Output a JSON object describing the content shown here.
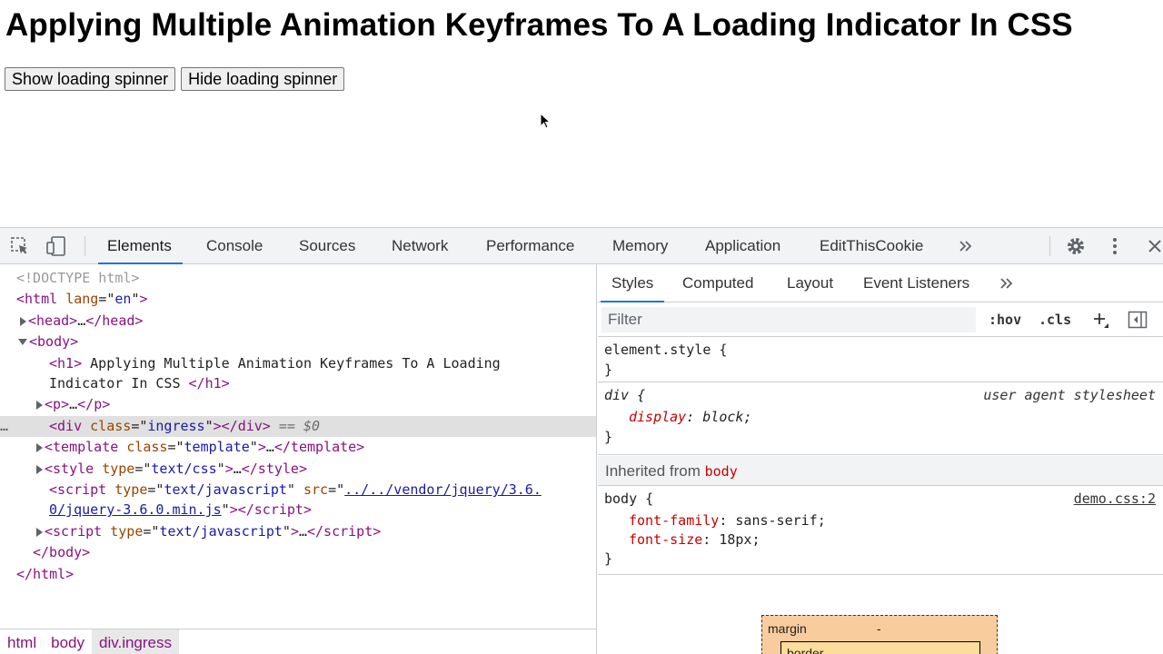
{
  "page": {
    "title": "Applying Multiple Animation Keyframes To A Loading Indicator In CSS",
    "show_button": "Show loading spinner",
    "hide_button": "Hide loading spinner"
  },
  "devtools": {
    "tabs": [
      "Elements",
      "Console",
      "Sources",
      "Network",
      "Performance",
      "Memory",
      "Application",
      "EditThisCookie"
    ],
    "active_tab": "Elements",
    "more_tabs_icon": "chevron-double-right-icon",
    "icons": [
      "inspect-element-icon",
      "device-toolbar-icon",
      "gear-icon",
      "kebab-menu-icon",
      "close-icon"
    ],
    "accent_color": "#1a73e8"
  },
  "dom": {
    "doctype": "<!DOCTYPE html>",
    "html_open_tag": "html",
    "html_attr_name": "lang",
    "html_attr_value": "en",
    "head_tag": "head",
    "body_tag": "body",
    "h1_text_1": " Applying Multiple Animation Keyframes To A Loading",
    "h1_text_2": "Indicator In CSS ",
    "p_tag": "p",
    "div_class": "ingress",
    "selected_marker": " == $0",
    "template_class": "template",
    "style_type": "text/css",
    "script_type": "text/javascript",
    "script_src_1": "../../vendor/jquery/3.6.",
    "script_src_2": "0/jquery-3.6.0.min.js",
    "ellipsis": "…"
  },
  "breadcrumbs": [
    "html",
    "body",
    "div.ingress"
  ],
  "styles": {
    "tabs": [
      "Styles",
      "Computed",
      "Layout",
      "Event Listeners"
    ],
    "active_tab": "Styles",
    "filter_placeholder": "Filter",
    "hov": ":hov",
    "cls": ".cls",
    "element_style": "element.style {",
    "rule_div_selector": "div {",
    "rule_div_source": "user agent stylesheet",
    "rule_div_prop": "display",
    "rule_div_value": "block",
    "inherited_label": "Inherited from",
    "inherited_from": "body",
    "rule_body_selector": "body {",
    "rule_body_source": "demo.css:2",
    "rule_body_props": [
      {
        "name": "font-family",
        "value": "sans-serif"
      },
      {
        "name": "font-size",
        "value": "18px"
      }
    ],
    "close_brace": "}",
    "box_model": {
      "margin_label": "margin",
      "margin_value": "-",
      "border_label": "border"
    }
  }
}
